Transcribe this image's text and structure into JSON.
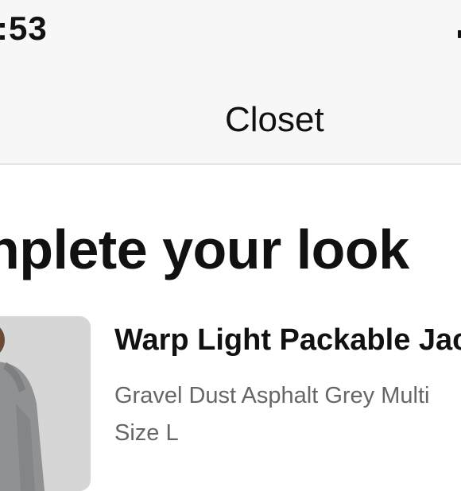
{
  "status_bar": {
    "time": ":53",
    "icon": "signal-icon"
  },
  "nav": {
    "title": "Closet"
  },
  "section": {
    "heading": "nplete your look"
  },
  "product": {
    "title": "Warp Light Packable Jac",
    "color": "Gravel Dust Asphalt Grey Multi",
    "size": "Size L",
    "image_icon": "product-photo"
  }
}
